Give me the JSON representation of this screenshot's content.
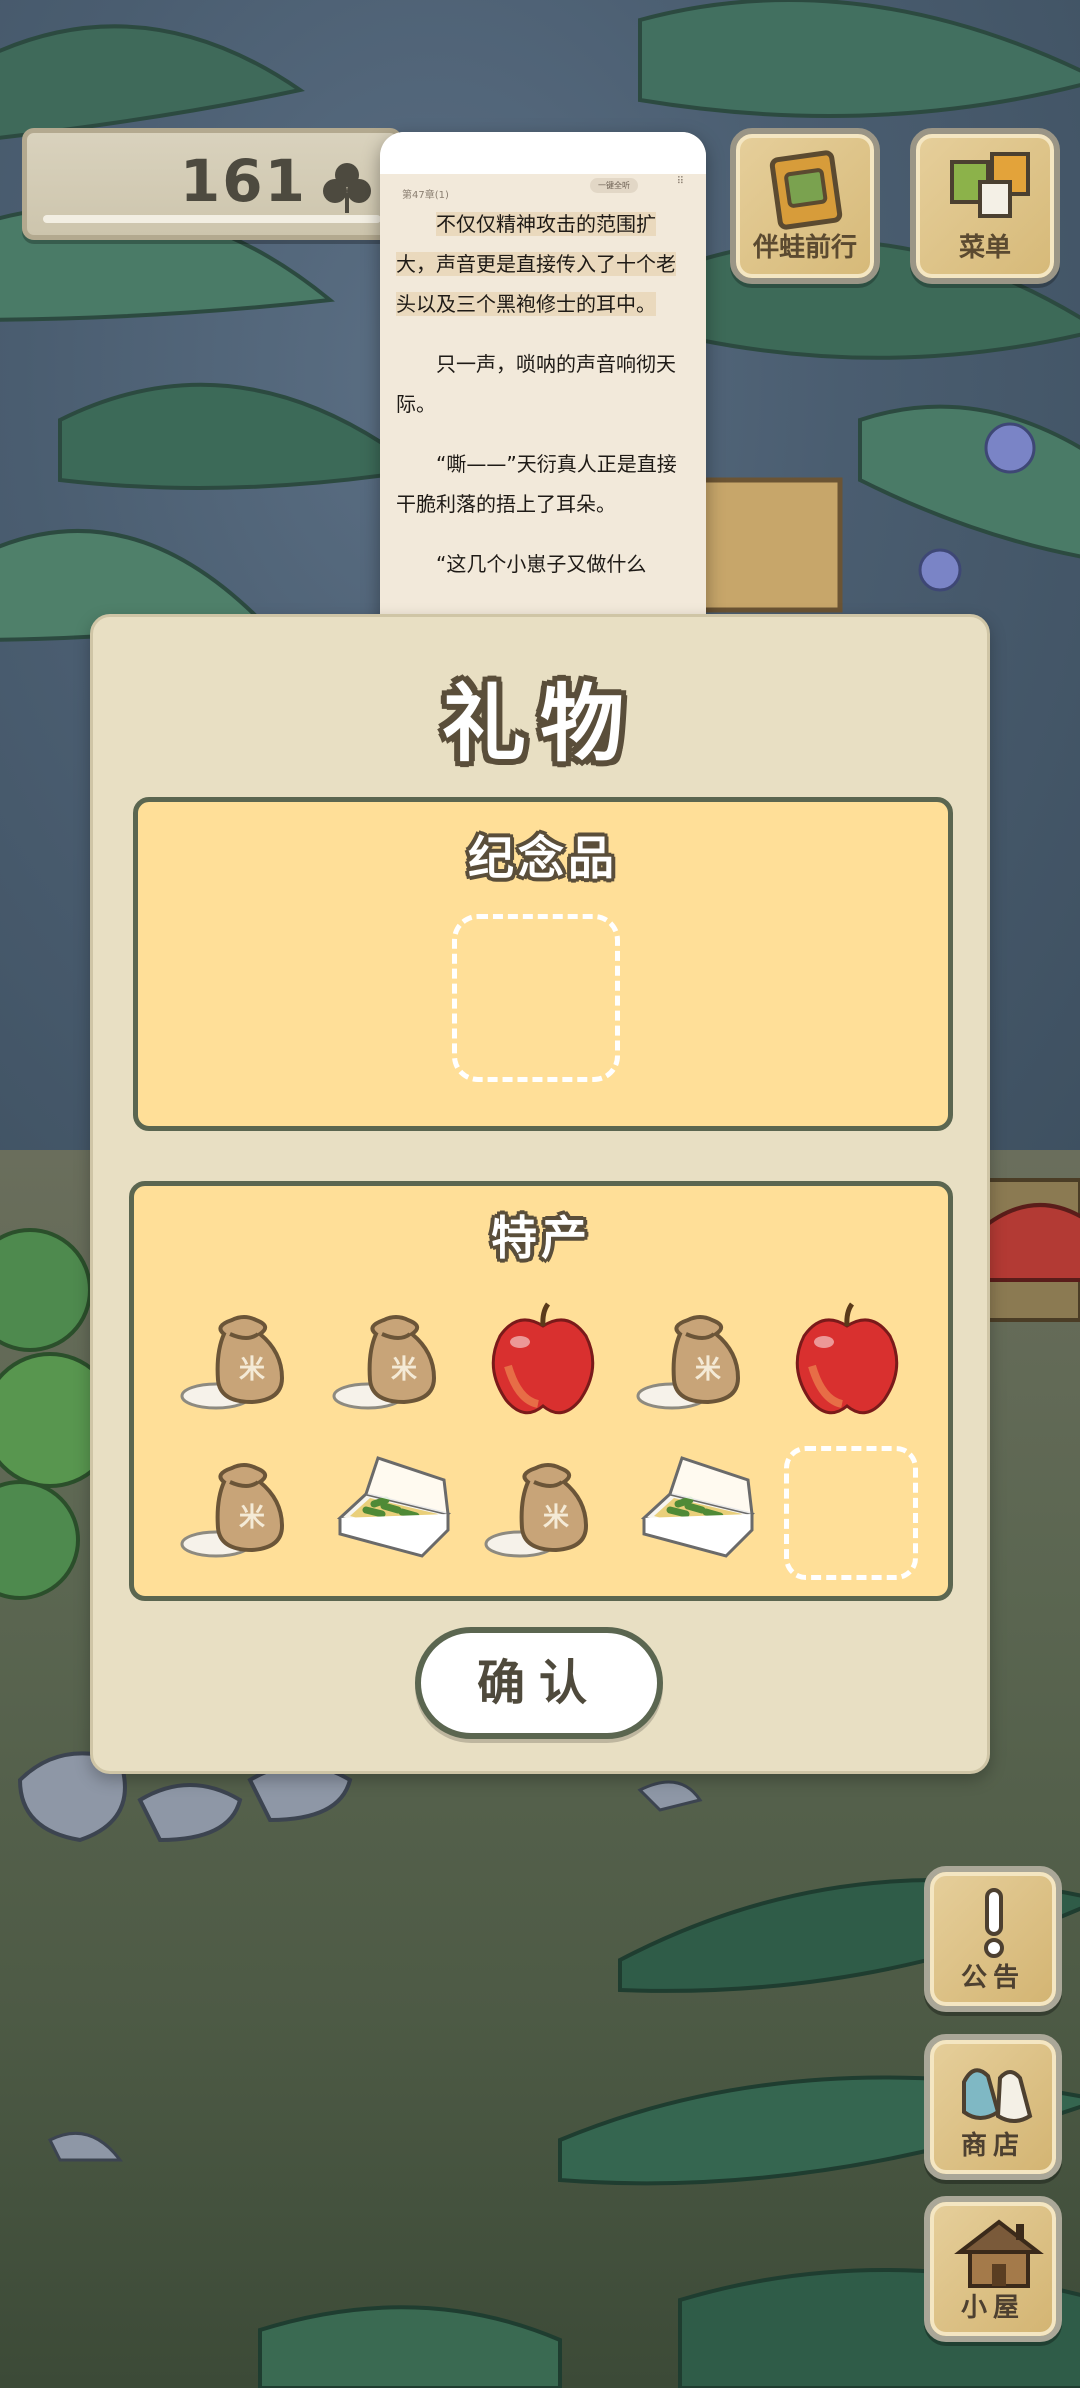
{
  "hud": {
    "clover_count": "161",
    "travel_label": "伴蛙前行",
    "menu_label": "菜单"
  },
  "reader": {
    "chapter": "第47章(1)",
    "site_text": "",
    "pill_text": "一键全听",
    "paragraphs": [
      "不仅仅精神攻击的范围扩大，声音更是直接传入了十个老头以及三个黑袍修士的耳中。",
      "只一声，唢呐的声音响彻天际。",
      "“嘶——”天衍真人正是直接干脆利落的捂上了耳朵。",
      "“这几个小崽子又做什么"
    ]
  },
  "gift_dialog": {
    "title": "礼物",
    "souvenir_title": "纪念品",
    "specialty_title": "特产",
    "items": [
      {
        "name": "rice-bag",
        "glyph": "米"
      },
      {
        "name": "rice-bag",
        "glyph": "米"
      },
      {
        "name": "apple"
      },
      {
        "name": "rice-bag",
        "glyph": "米"
      },
      {
        "name": "apple"
      },
      {
        "name": "rice-bag",
        "glyph": "米"
      },
      {
        "name": "bento-box"
      },
      {
        "name": "rice-bag",
        "glyph": "米"
      },
      {
        "name": "bento-box"
      },
      {
        "name": "empty"
      }
    ],
    "confirm_label": "确认"
  },
  "side_buttons": {
    "notice_label": "公告",
    "shop_label": "商店",
    "house_label": "小屋"
  },
  "colors": {
    "panel": "#e8dfc3",
    "section": "#ffdf98",
    "outline": "#5b6650",
    "button_wood": "#d6b978"
  }
}
